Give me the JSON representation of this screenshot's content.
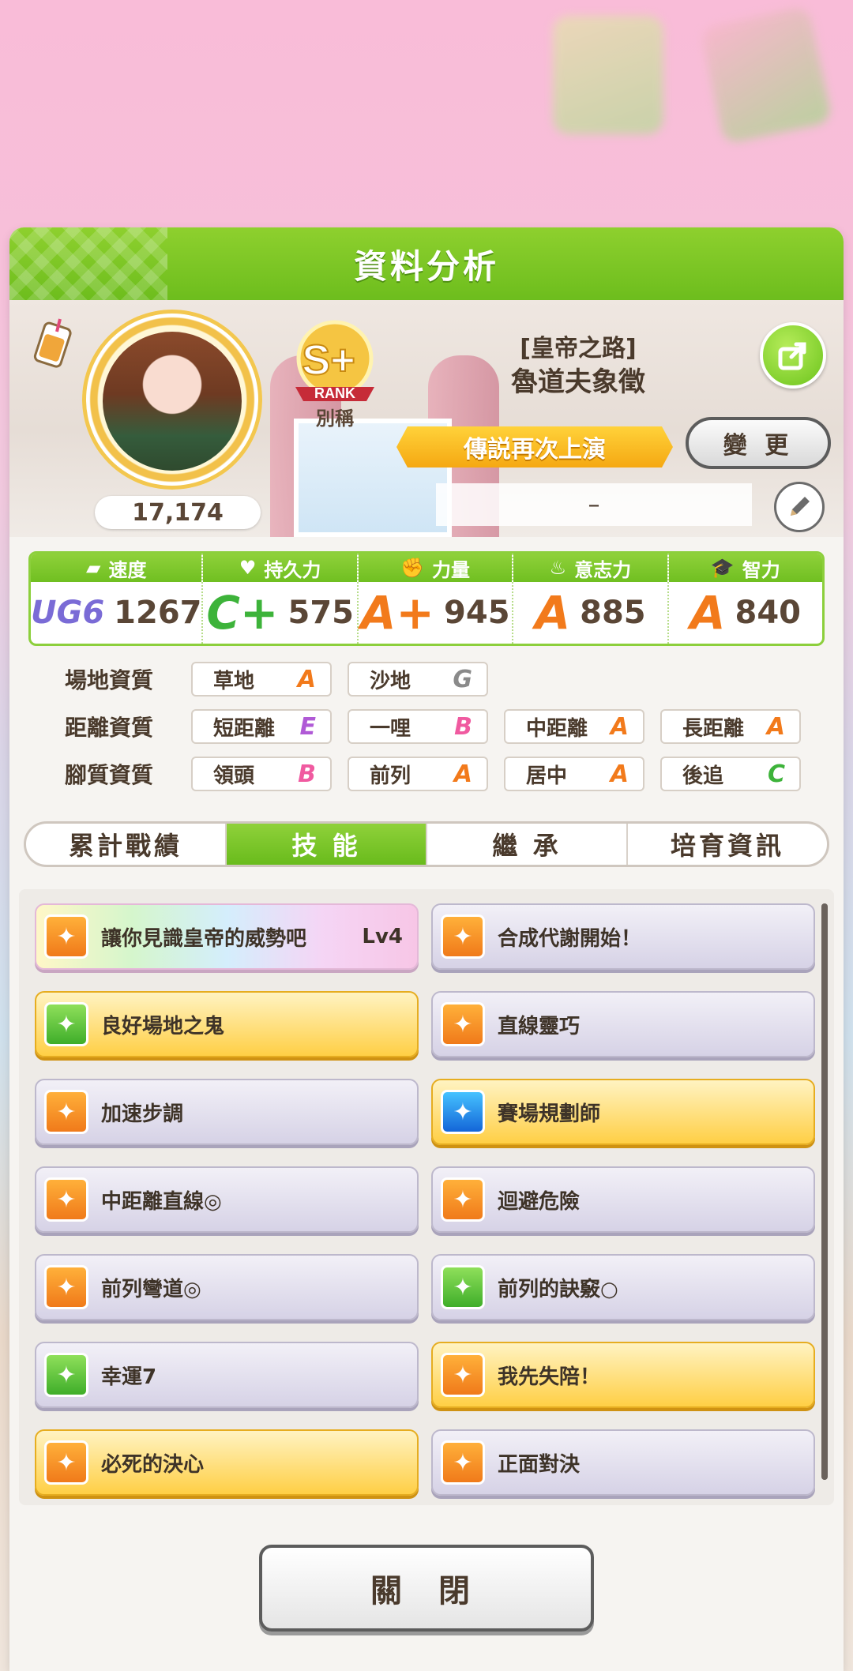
{
  "dialog": {
    "title": "資料分析"
  },
  "profile": {
    "score": "17,174",
    "rank": {
      "grade": "S+",
      "label": "RANK",
      "sub": "別稱"
    },
    "epithet": "[皇帝之路]",
    "name": "魯道夫象徵",
    "title_banner": "傳説再次上演",
    "change_label": "變 更",
    "memo": "–"
  },
  "stats": [
    {
      "label": "速度",
      "icon": "shoe-icon",
      "grade": "UG6",
      "value": "1267"
    },
    {
      "label": "持久力",
      "icon": "heart-icon",
      "grade": "C+",
      "value": "575"
    },
    {
      "label": "力量",
      "icon": "muscle-icon",
      "grade": "A+",
      "value": "945"
    },
    {
      "label": "意志力",
      "icon": "flame-icon",
      "grade": "A",
      "value": "885"
    },
    {
      "label": "智力",
      "icon": "graduation-cap-icon",
      "grade": "A",
      "value": "840"
    }
  ],
  "aptitude": {
    "track": {
      "label": "場地資質",
      "items": [
        {
          "name": "草地",
          "grade": "A"
        },
        {
          "name": "沙地",
          "grade": "G"
        }
      ]
    },
    "distance": {
      "label": "距離資質",
      "items": [
        {
          "name": "短距離",
          "grade": "E"
        },
        {
          "name": "一哩",
          "grade": "B"
        },
        {
          "name": "中距離",
          "grade": "A"
        },
        {
          "name": "長距離",
          "grade": "A"
        }
      ]
    },
    "style": {
      "label": "腳質資質",
      "items": [
        {
          "name": "領頭",
          "grade": "B"
        },
        {
          "name": "前列",
          "grade": "A"
        },
        {
          "name": "居中",
          "grade": "A"
        },
        {
          "name": "後追",
          "grade": "C"
        }
      ]
    }
  },
  "tabs": [
    "累計戰績",
    "技 能",
    "繼 承",
    "培育資訊"
  ],
  "skills": [
    {
      "name": "讓你見識皇帝的威勢吧",
      "level": "Lv4",
      "style": "rainbow",
      "icon": "orange"
    },
    {
      "name": "合成代謝開始！",
      "level": "",
      "style": "plain",
      "icon": "orange"
    },
    {
      "name": "良好場地之鬼",
      "level": "",
      "style": "gold",
      "icon": "green"
    },
    {
      "name": "直線靈巧",
      "level": "",
      "style": "plain",
      "icon": "orange"
    },
    {
      "name": "加速步調",
      "level": "",
      "style": "plain",
      "icon": "orange"
    },
    {
      "name": "賽場規劃師",
      "level": "",
      "style": "gold",
      "icon": "blue"
    },
    {
      "name": "中距離直線◎",
      "level": "",
      "style": "plain",
      "icon": "orange"
    },
    {
      "name": "迴避危險",
      "level": "",
      "style": "plain",
      "icon": "orange"
    },
    {
      "name": "前列彎道◎",
      "level": "",
      "style": "plain",
      "icon": "orange"
    },
    {
      "name": "前列的訣竅○",
      "level": "",
      "style": "plain",
      "icon": "green"
    },
    {
      "name": "幸運7",
      "level": "",
      "style": "plain",
      "icon": "green"
    },
    {
      "name": "我先失陪！",
      "level": "",
      "style": "gold",
      "icon": "orange"
    },
    {
      "name": "必死的決心",
      "level": "",
      "style": "gold",
      "icon": "orange"
    },
    {
      "name": "正面對決",
      "level": "",
      "style": "plain",
      "icon": "orange"
    }
  ],
  "close_label": "關 閉",
  "colors": {
    "accent_green": "#6dbd1d",
    "grade_A": "#f27a1b",
    "grade_C": "#3db33a",
    "grade_B": "#f05aa0",
    "grade_E": "#b05ad6",
    "grade_G": "#8a8a8a"
  }
}
